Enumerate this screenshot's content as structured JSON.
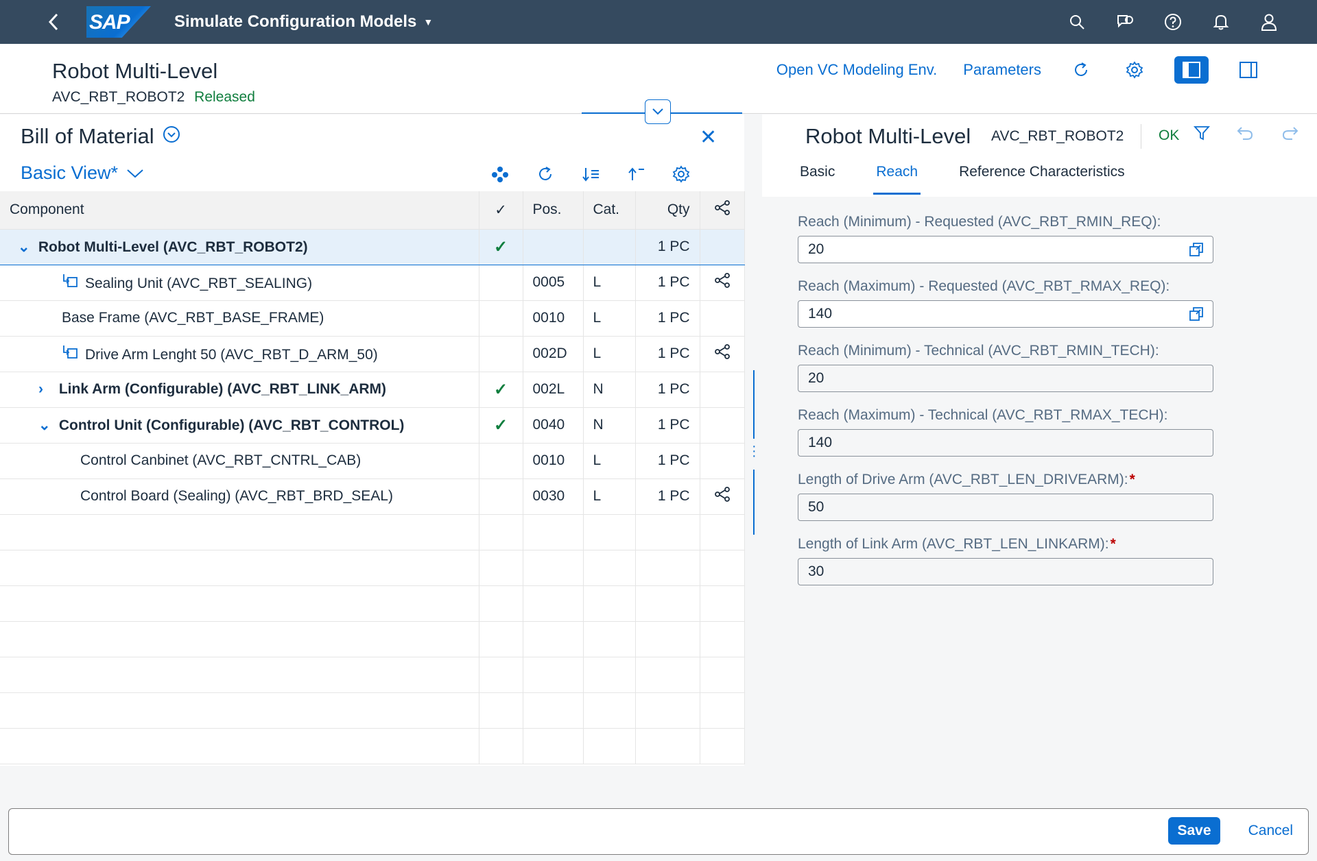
{
  "shell": {
    "back_icon": "chevron-left-icon",
    "logo": "SAP",
    "app_title": "Simulate Configuration Models",
    "icons": [
      "search-icon",
      "feedback-icon",
      "help-icon",
      "notification-icon",
      "user-icon"
    ]
  },
  "header": {
    "title": "Robot Multi-Level",
    "code": "AVC_RBT_ROBOT2",
    "status": "Released",
    "status_color": "#107e3e",
    "open_vc": "Open VC Modeling Env.",
    "parameters": "Parameters"
  },
  "bom": {
    "title": "Bill of Material",
    "view": "Basic View*",
    "columns": {
      "component": "Component",
      "check": "✓",
      "pos": "Pos.",
      "cat": "Cat.",
      "qty": "Qty"
    },
    "rows": [
      {
        "expander": "⌄",
        "label": "Robot Multi-Level (AVC_RBT_ROBOT2)",
        "check": "✓",
        "pos": "",
        "cat": "",
        "qty": "1 PC"
      },
      {
        "label": "Sealing Unit (AVC_RBT_SEALING)",
        "check": "",
        "pos": "0005",
        "cat": "L",
        "qty": "1 PC"
      },
      {
        "label": "Base Frame (AVC_RBT_BASE_FRAME)",
        "check": "",
        "pos": "0010",
        "cat": "L",
        "qty": "1 PC"
      },
      {
        "label": "Drive Arm Lenght 50 (AVC_RBT_D_ARM_50)",
        "check": "",
        "pos": "002D",
        "cat": "L",
        "qty": "1 PC"
      },
      {
        "expander": "›",
        "label": "Link Arm (Configurable) (AVC_RBT_LINK_ARM)",
        "check": "✓",
        "pos": "002L",
        "cat": "N",
        "qty": "1 PC"
      },
      {
        "expander": "⌄",
        "label": "Control Unit (Configurable) (AVC_RBT_CONTROL)",
        "check": "✓",
        "pos": "0040",
        "cat": "N",
        "qty": "1 PC"
      },
      {
        "label": "Control Canbinet (AVC_RBT_CNTRL_CAB)",
        "check": "",
        "pos": "0010",
        "cat": "L",
        "qty": "1 PC"
      },
      {
        "label": "Control Board (Sealing) (AVC_RBT_BRD_SEAL)",
        "check": "",
        "pos": "0030",
        "cat": "L",
        "qty": "1 PC"
      }
    ]
  },
  "detail": {
    "title": "Robot Multi-Level",
    "code": "AVC_RBT_ROBOT2",
    "ok": "OK",
    "tabs": [
      "Basic",
      "Reach",
      "Reference Characteristics"
    ],
    "active_tab": "Reach",
    "fields": [
      {
        "label": "Reach (Minimum) - Requested (AVC_RBT_RMIN_REQ):",
        "value": "20",
        "readonly": false,
        "required": false
      },
      {
        "label": "Reach (Maximum) - Requested (AVC_RBT_RMAX_REQ):",
        "value": "140",
        "readonly": false,
        "required": false
      },
      {
        "label": "Reach (Minimum) - Technical (AVC_RBT_RMIN_TECH):",
        "value": "20",
        "readonly": true,
        "required": false
      },
      {
        "label": "Reach (Maximum) - Technical (AVC_RBT_RMAX_TECH):",
        "value": "140",
        "readonly": true,
        "required": false
      },
      {
        "label": "Length of Drive Arm (AVC_RBT_LEN_DRIVEARM):",
        "value": "50",
        "readonly": true,
        "required": true
      },
      {
        "label": "Length of Link Arm (AVC_RBT_LEN_LINKARM):",
        "value": "30",
        "readonly": true,
        "required": true
      }
    ],
    "required_mark": "*"
  },
  "footer": {
    "save": "Save",
    "cancel": "Cancel"
  },
  "colors": {
    "shell": "#354a5f",
    "accent": "#0a6ed1",
    "positive": "#107e3e"
  }
}
